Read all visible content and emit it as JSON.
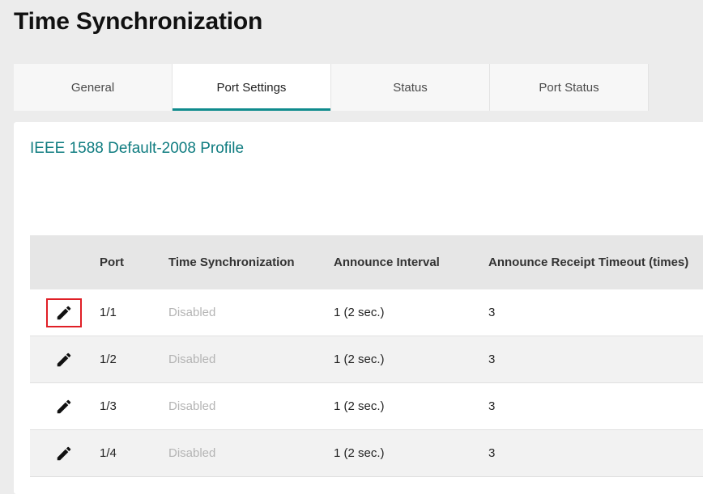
{
  "page": {
    "title": "Time Synchronization"
  },
  "tabs": [
    {
      "label": "General",
      "active": false
    },
    {
      "label": "Port Settings",
      "active": true
    },
    {
      "label": "Status",
      "active": false
    },
    {
      "label": "Port Status",
      "active": false
    }
  ],
  "profile": {
    "title": "IEEE 1588 Default-2008 Profile"
  },
  "table": {
    "headers": {
      "port": "Port",
      "time_sync": "Time Synchronization",
      "announce_interval": "Announce Interval",
      "announce_timeout": "Announce Receipt Timeout (times)"
    },
    "rows": [
      {
        "port": "1/1",
        "time_sync": "Disabled",
        "announce_interval": "1 (2 sec.)",
        "announce_timeout": "3",
        "edit_icon": "pencil-icon",
        "highlighted": true
      },
      {
        "port": "1/2",
        "time_sync": "Disabled",
        "announce_interval": "1 (2 sec.)",
        "announce_timeout": "3",
        "edit_icon": "pencil-icon",
        "highlighted": false
      },
      {
        "port": "1/3",
        "time_sync": "Disabled",
        "announce_interval": "1 (2 sec.)",
        "announce_timeout": "3",
        "edit_icon": "pencil-icon",
        "highlighted": false
      },
      {
        "port": "1/4",
        "time_sync": "Disabled",
        "announce_interval": "1 (2 sec.)",
        "announce_timeout": "3",
        "edit_icon": "pencil-icon",
        "highlighted": false
      }
    ]
  },
  "colors": {
    "accent": "#0f8b8d",
    "profile_title": "#0f7c80",
    "highlight_border": "#e01f26",
    "disabled_text": "#b4b4b4"
  }
}
